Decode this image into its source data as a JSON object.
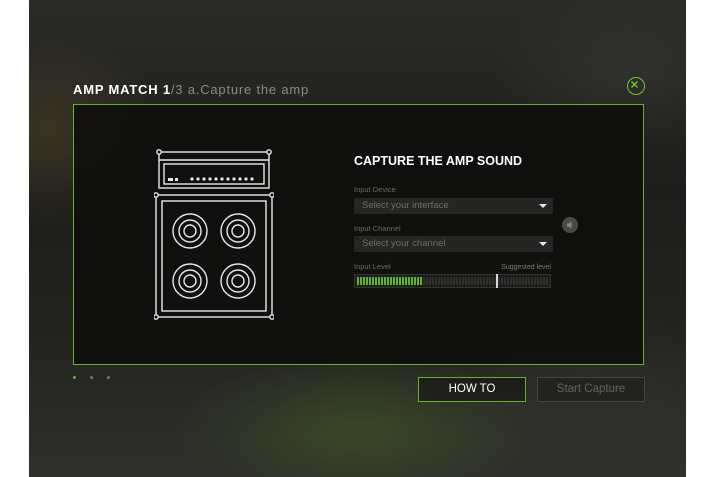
{
  "header": {
    "step_title": "AMP MATCH 1",
    "step_total": "/3",
    "step_description": "a.Capture the amp"
  },
  "close_icon": "close-circle-icon",
  "capture": {
    "title": "CAPTURE THE AMP SOUND",
    "input_device": {
      "label": "Input Device",
      "value": "Select your interface"
    },
    "input_channel": {
      "label": "Input Channel",
      "value": "Select your channel"
    },
    "input_level": {
      "label": "Input Level",
      "suggested_label": "Suggested level",
      "level": 0.33,
      "suggested": 0.72
    }
  },
  "pagination": {
    "count": 3,
    "active": 0
  },
  "buttons": {
    "how_to": "HOW TO",
    "start_capture": "Start Capture"
  },
  "colors": {
    "accent": "#5eb524",
    "background": "#1e1e1c",
    "panel": "#0e0e0d"
  }
}
